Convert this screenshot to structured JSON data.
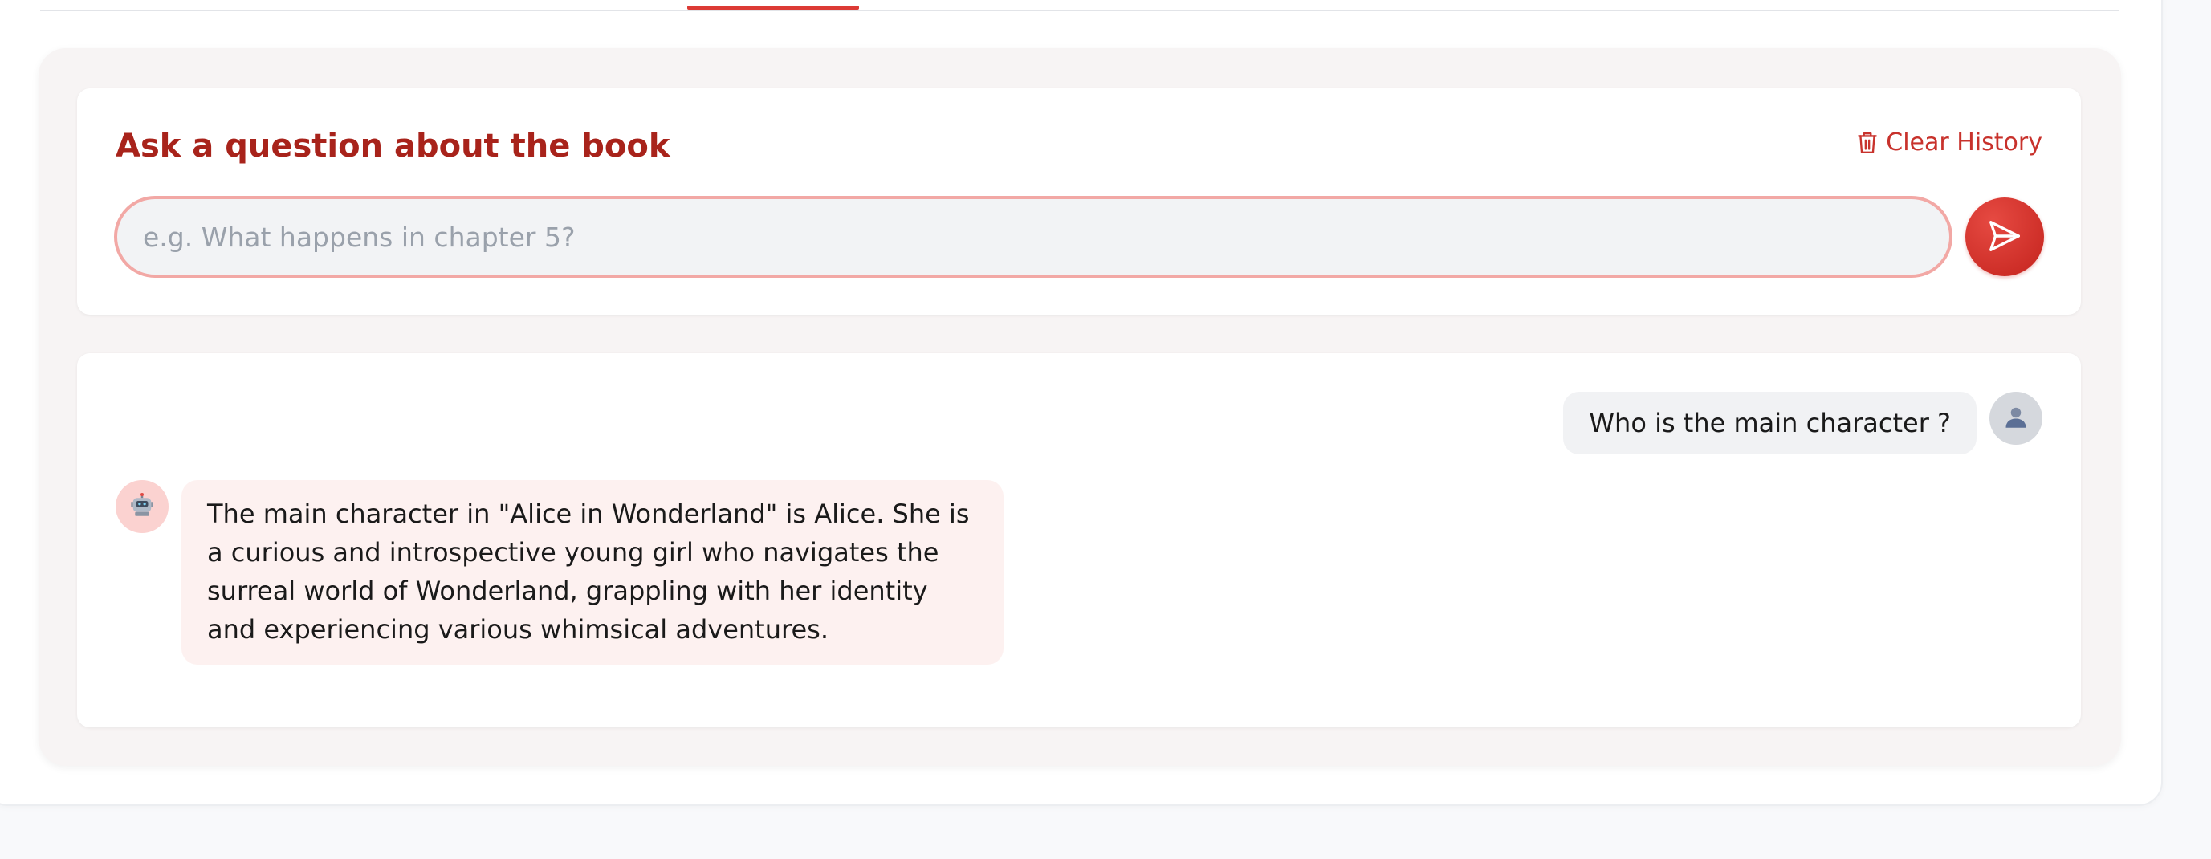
{
  "ask": {
    "title": "Ask a question about the book",
    "clear_label": "Clear History",
    "input_placeholder": "e.g. What happens in chapter 5?",
    "input_value": ""
  },
  "chat": {
    "messages": [
      {
        "role": "user",
        "text": "Who is the main character ?"
      },
      {
        "role": "assistant",
        "text": "The main character in \"Alice in Wonderland\" is Alice. She is a curious and introspective young girl who navigates the surreal world of Wonderland, grappling with her identity and experiencing various whimsical adventures."
      }
    ]
  },
  "icons": {
    "clear": "trash-icon",
    "send": "send-icon",
    "user_avatar": "user-icon",
    "bot_avatar": "robot-icon"
  },
  "colors": {
    "accent": "#dc3a35",
    "title": "#a8231b",
    "input_border": "#f2a8a5",
    "bot_bubble": "#fdf1f0",
    "user_bubble": "#f1f2f4"
  }
}
